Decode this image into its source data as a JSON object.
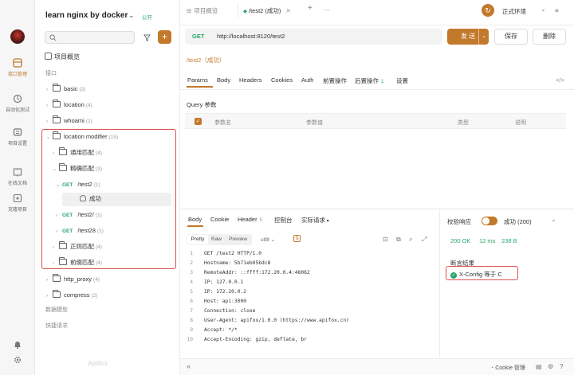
{
  "rail": {
    "items": [
      {
        "label": "接口管理",
        "icon": "api-icon"
      },
      {
        "label": "自动化测试",
        "icon": "test-icon"
      },
      {
        "label": "项目设置",
        "icon": "settings-icon"
      },
      {
        "label": "在线文档",
        "icon": "doc-icon"
      },
      {
        "label": "克隆项目",
        "icon": "clone-icon"
      }
    ]
  },
  "sidebar": {
    "project_name": "learn nginx by docker",
    "visibility": "公开",
    "overview": "项目概览",
    "section_label": "接口",
    "tree": [
      {
        "label": "basic",
        "count": "(2)"
      },
      {
        "label": "location",
        "count": "(4)"
      },
      {
        "label": "whoami",
        "count": "(1)"
      },
      {
        "label": "location modifier",
        "count": "(15)"
      },
      {
        "label": "通用匹配",
        "count": "(4)"
      },
      {
        "label": "精确匹配",
        "count": "(3)"
      },
      {
        "method": "GET",
        "label": "/test2",
        "count": "(1)"
      },
      {
        "label": "成功"
      },
      {
        "method": "GET",
        "label": "/test2/",
        "count": "(1)"
      },
      {
        "method": "GET",
        "label": "/test28",
        "count": "(1)"
      },
      {
        "label": "正则匹配",
        "count": "(4)"
      },
      {
        "label": "前缀匹配",
        "count": "(4)"
      },
      {
        "label": "http_proxy",
        "count": "(4)"
      },
      {
        "label": "compress",
        "count": "(2)"
      }
    ],
    "models": "数据模型",
    "quick_requests": "快捷请求",
    "watermark": "Apifox"
  },
  "topbar": {
    "tab_overview": "项目概览",
    "tab_active": "/test2 (成功)",
    "env": "正式环境"
  },
  "request": {
    "method": "GET",
    "url": "http://localhost:8120/test2",
    "send": "发 送",
    "save": "保存",
    "delete": "删除",
    "title": "/test2（成功）",
    "tabs": [
      "Params",
      "Body",
      "Headers",
      "Cookies",
      "Auth",
      "前置操作",
      "后置操作",
      "设置"
    ],
    "post_count": "1",
    "query_title": "Query 参数",
    "columns": [
      "参数名",
      "参数值",
      "类型",
      "说明"
    ]
  },
  "response": {
    "tabs": [
      "Body",
      "Cookie",
      "Header",
      "控制台",
      "实际请求"
    ],
    "header_count": "5",
    "views": [
      "Pretty",
      "Raw",
      "Preview"
    ],
    "encoding": "utf8",
    "lines": [
      "GET /test2 HTTP/1.0",
      "Hostname: 5b71eb05bdc8",
      "RemoteAddr: ::ffff:172.20.0.4:48062",
      "IP: 127.0.0.1",
      "IP: 172.20.0.2",
      "Host: api:3000",
      "Connection: close",
      "User-Agent: apifox/1.0.0 (https://www.apifox.cn)",
      "Accept: */*",
      "Accept-Encoding: gzip, deflate, br"
    ],
    "validate_label": "校验响应",
    "validate_result": "成功 (200)",
    "status": "200 OK",
    "time": "12 ms",
    "size": "238 B",
    "assert_title": "断言结果",
    "assert_item": "X-Config 等于 C"
  },
  "footer": {
    "cookie": "Cookie 管理"
  },
  "colors": {
    "accent": "#c2792b",
    "get": "#2aa66c",
    "highlight": "#d9534f"
  }
}
